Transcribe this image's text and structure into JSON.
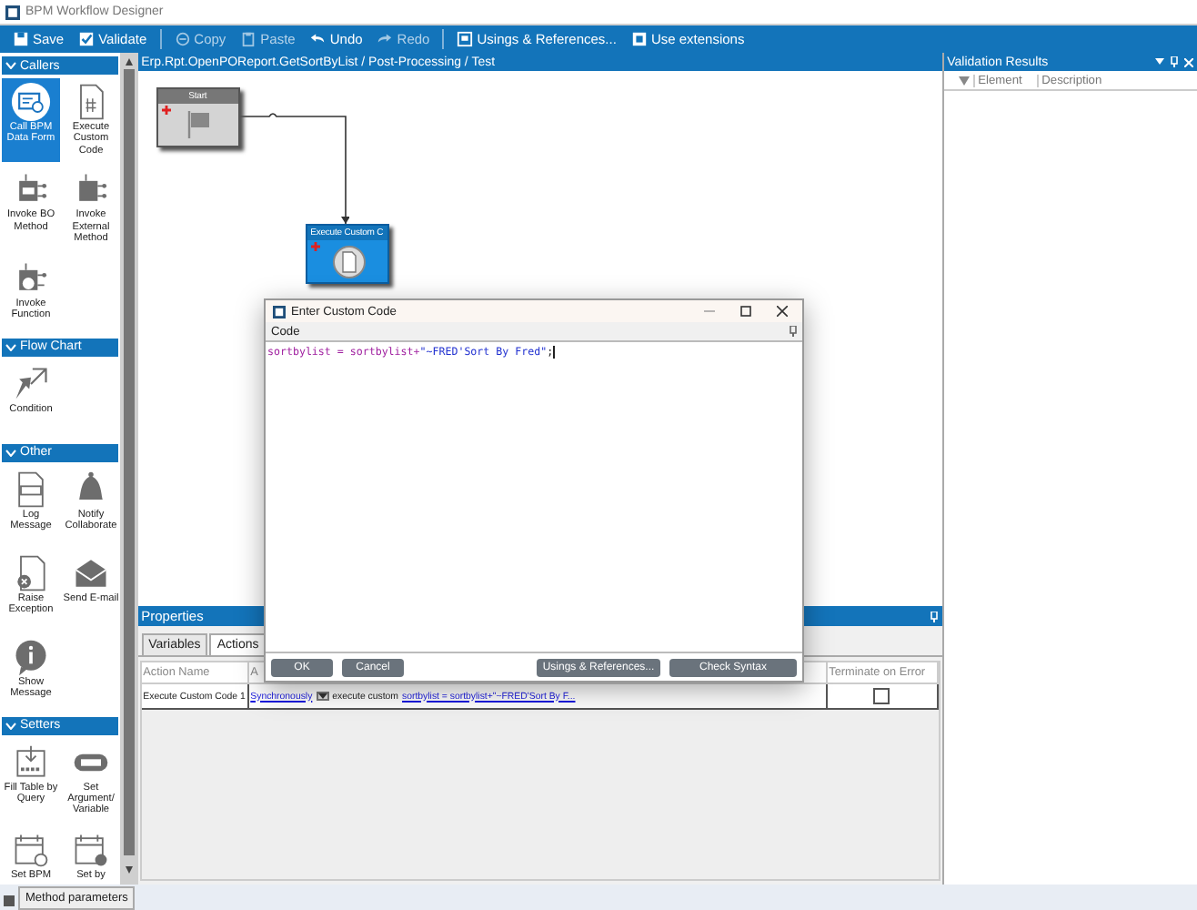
{
  "window": {
    "title": "BPM Workflow Designer"
  },
  "toolbar": [
    {
      "label": "Save",
      "kind": "save",
      "disabled": false
    },
    {
      "label": "Validate",
      "kind": "validate",
      "disabled": false
    },
    {
      "label": "Copy",
      "kind": "copy",
      "disabled": true
    },
    {
      "label": "Paste",
      "kind": "paste",
      "disabled": true
    },
    {
      "label": "Undo",
      "kind": "undo",
      "disabled": false
    },
    {
      "label": "Redo",
      "kind": "redo",
      "disabled": true
    },
    {
      "label": "Usings & References...",
      "kind": "usings",
      "disabled": false
    },
    {
      "label": "Use extensions",
      "kind": "extensions",
      "disabled": false
    }
  ],
  "palette": {
    "sections": [
      {
        "title": "Callers",
        "items": [
          {
            "label": "Call BPM Data Form",
            "kind": "form",
            "selected": true
          },
          {
            "label": "Execute Custom Code",
            "kind": "code",
            "selected": false
          },
          {
            "label": "Invoke BO Method",
            "kind": "bo",
            "selected": false
          },
          {
            "label": "Invoke External Method",
            "kind": "external",
            "selected": false
          },
          {
            "label": "Invoke Function",
            "kind": "function",
            "selected": false
          }
        ]
      },
      {
        "title": "Flow Chart",
        "items": [
          {
            "label": "Condition",
            "kind": "condition",
            "selected": false
          }
        ]
      },
      {
        "title": "Other",
        "items": [
          {
            "label": "Log Message",
            "kind": "log",
            "selected": false
          },
          {
            "label": "Notify Collaborate",
            "kind": "bell",
            "selected": false
          },
          {
            "label": "Raise Exception",
            "kind": "exception",
            "selected": false
          },
          {
            "label": "Send E-mail",
            "kind": "mail",
            "selected": false
          },
          {
            "label": "Show Message",
            "kind": "info",
            "selected": false
          }
        ]
      },
      {
        "title": "Setters",
        "items": [
          {
            "label": "Fill Table by Query",
            "kind": "fill",
            "selected": false
          },
          {
            "label": "Set Argument/ Variable",
            "kind": "abc",
            "selected": false
          },
          {
            "label": "Set BPM",
            "kind": "calendar",
            "selected": false
          },
          {
            "label": "Set by",
            "kind": "calendar_query",
            "selected": false
          }
        ]
      }
    ]
  },
  "canvas": {
    "breadcrumb": "Erp.Rpt.OpenPOReport.GetSortByList / Post-Processing / Test",
    "nodes": [
      {
        "title": "Start",
        "kind": "start"
      },
      {
        "title": "Execute Custom C",
        "kind": "custom_code"
      }
    ]
  },
  "properties": {
    "title": "Properties",
    "tabs": [
      {
        "label": "Variables",
        "selected": false
      },
      {
        "label": "Actions",
        "selected": true
      }
    ],
    "columns": [
      "Action Name",
      "A",
      "Terminate on Error"
    ],
    "rows": [
      {
        "action_name": "Execute Custom Code 1",
        "mode": "Synchronously",
        "verb": "execute custom",
        "code": "sortbylist = sortbylist+\"~FRED'Sort By F...",
        "terminate_on_error": false
      }
    ]
  },
  "validation": {
    "title": "Validation Results",
    "columns": [
      "Element",
      "Description"
    ]
  },
  "bottom_tabs": [
    {
      "label": "Method parameters"
    }
  ],
  "dialog": {
    "title": "Enter Custom Code",
    "section": "Code",
    "code": [
      {
        "text": "sortbylist = sortbylist+",
        "kind": "identifier"
      },
      {
        "text": "\"~FRED'Sort By Fred\"",
        "kind": "string"
      },
      {
        "text": ";",
        "kind": "plain"
      }
    ],
    "buttons": [
      "OK",
      "Cancel",
      "Usings & References...",
      "Check Syntax"
    ]
  }
}
